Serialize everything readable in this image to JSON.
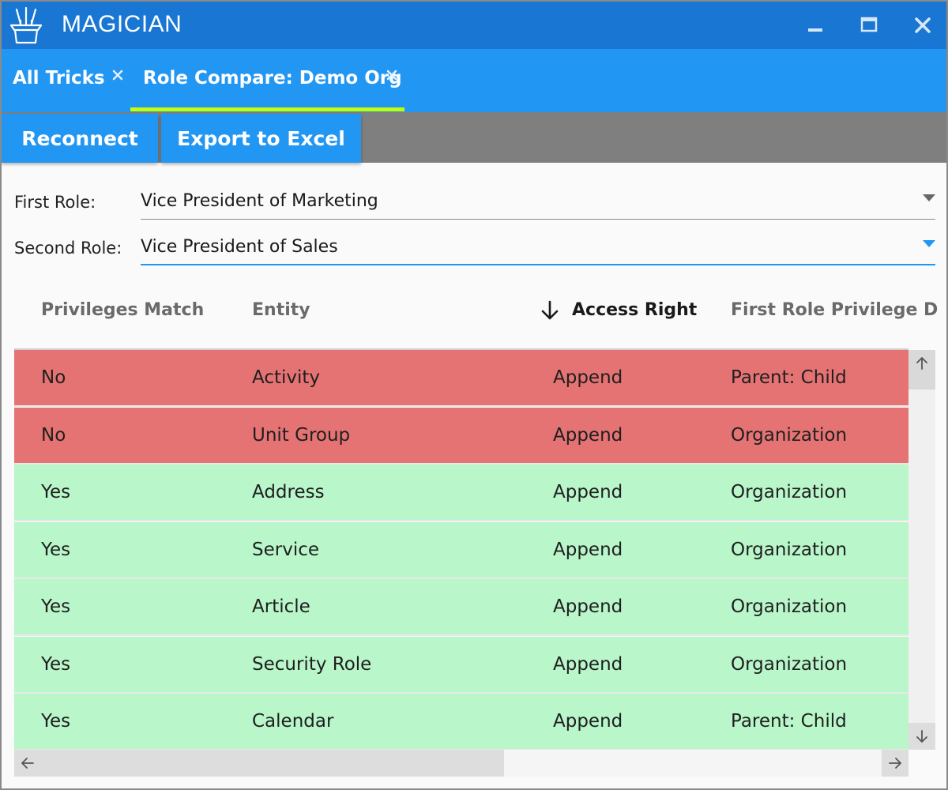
{
  "app": {
    "title": "MAGICIAN",
    "icon": "magic-hat-icon",
    "window_controls": [
      "minimize-icon",
      "maximize-icon",
      "close-icon"
    ],
    "accent_color": "#1976d2"
  },
  "tabs": [
    {
      "label": "All Tricks",
      "active": false
    },
    {
      "label": "Role Compare: Demo Org",
      "active": true
    }
  ],
  "toolbar": {
    "reconnect_label": "Reconnect",
    "export_label": "Export to Excel"
  },
  "form": {
    "first_role": {
      "label": "First Role:",
      "value": "Vice President of Marketing"
    },
    "second_role": {
      "label": "Second Role:",
      "value": "Vice President of Sales"
    }
  },
  "grid": {
    "columns": [
      "Privileges Match",
      "Entity",
      "Access Right",
      "First Role Privilege D"
    ],
    "sorted_column": "Access Right",
    "sort_direction": "descending",
    "rows": [
      {
        "match": "No",
        "entity": "Activity",
        "access": "Append",
        "first_priv": "Parent: Child"
      },
      {
        "match": "No",
        "entity": "Unit Group",
        "access": "Append",
        "first_priv": "Organization"
      },
      {
        "match": "Yes",
        "entity": "Address",
        "access": "Append",
        "first_priv": "Organization"
      },
      {
        "match": "Yes",
        "entity": "Service",
        "access": "Append",
        "first_priv": "Organization"
      },
      {
        "match": "Yes",
        "entity": "Article",
        "access": "Append",
        "first_priv": "Organization"
      },
      {
        "match": "Yes",
        "entity": "Security Role",
        "access": "Append",
        "first_priv": "Organization"
      },
      {
        "match": "Yes",
        "entity": "Calendar",
        "access": "Append",
        "first_priv": "Parent: Child"
      }
    ],
    "row_colors": {
      "no": "#e57373",
      "yes": "#b9f6ca"
    }
  }
}
